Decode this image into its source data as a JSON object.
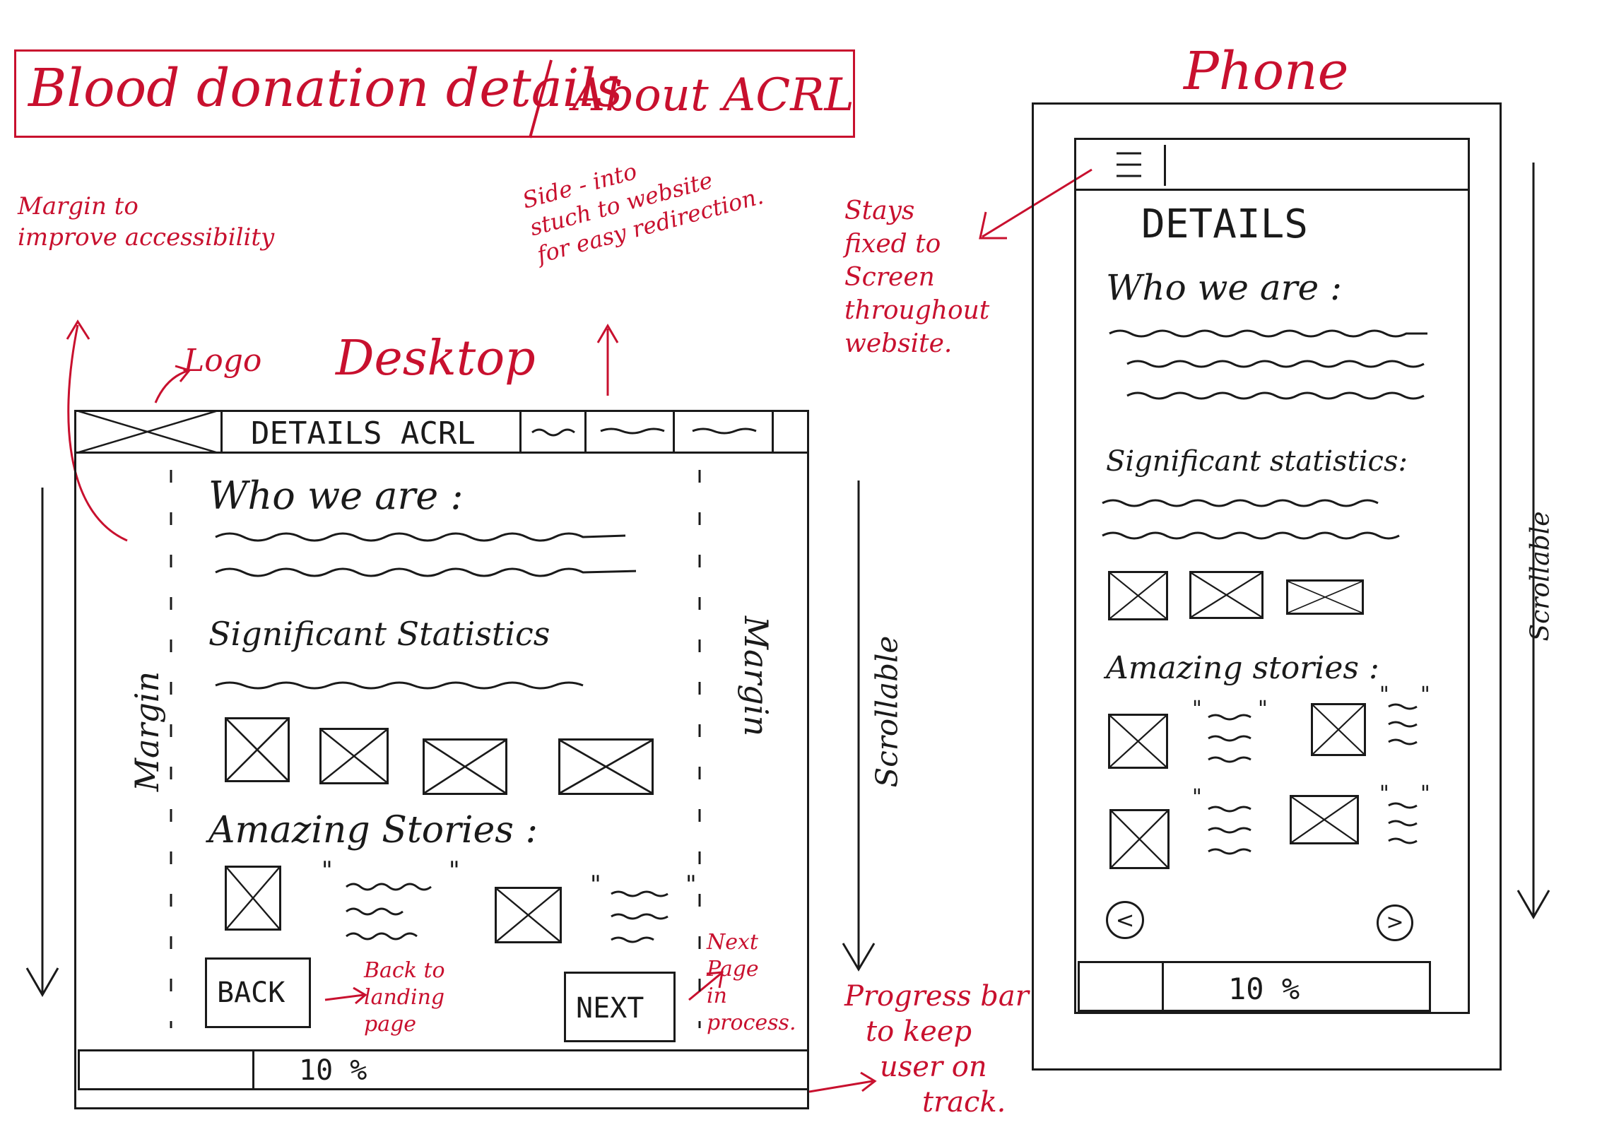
{
  "header": {
    "title": "Blood donation details",
    "subtitle": "About ACRL"
  },
  "annotations": {
    "margin_note": [
      "Margin to",
      "improve accessibility"
    ],
    "side_nav_note": [
      "Side - into",
      "stuch to website",
      "for easy redirection."
    ],
    "logo_note": "Logo",
    "desktop_label": "Desktop",
    "stays_fixed_note": [
      "Stays",
      "fixed to",
      "Screen",
      "throughout",
      "website."
    ],
    "back_note": [
      "Back to",
      "landing",
      "page"
    ],
    "next_note": [
      "Next",
      "Page",
      "in",
      "process."
    ],
    "progress_note": [
      "Progress bar",
      "to keep",
      "user on",
      "track."
    ],
    "phone_label": "Phone"
  },
  "desktop": {
    "nav_title": "DETAILS ACRL",
    "who_we_are": "Who we are :",
    "significant_statistics": "Significant Statistics",
    "amazing_stories": "Amazing Stories :",
    "back_button": "BACK",
    "next_button": "NEXT",
    "progress": "10 %",
    "progress_value": 0.1,
    "margin_left": "Margin",
    "margin_right": "Margin",
    "scrollable": "Scrollable"
  },
  "phone": {
    "heading": "DETAILS",
    "who_we_are": "Who we are :",
    "significant_statistics": "Significant statistics:",
    "amazing_stories": "Amazing stories :",
    "progress": "10 %",
    "progress_value": 0.1,
    "scrollable": "Scrollable",
    "prev_icon": "<",
    "next_icon": ">"
  },
  "colors": {
    "annotation": "#c8102e",
    "ink": "#1a1a1a"
  }
}
